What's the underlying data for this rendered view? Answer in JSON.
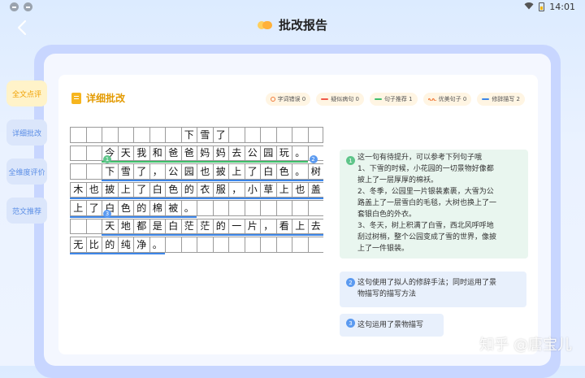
{
  "status_bar": {
    "time": "14:01"
  },
  "header": {
    "title": "批改报告"
  },
  "side_tabs": [
    {
      "label": "全文点评",
      "active": true
    },
    {
      "label": "详细批改",
      "active": false
    },
    {
      "label": "全维度评价",
      "active": false
    },
    {
      "label": "范文推荐",
      "active": false
    }
  ],
  "card": {
    "title": "详细批改",
    "legend": [
      {
        "label": "字词错误 0",
        "color": "#f07a3a",
        "mark": "circle"
      },
      {
        "label": "疑似病句 0",
        "color": "#f05a4a",
        "mark": "line"
      },
      {
        "label": "句子推荐 1",
        "color": "#3fbf6a",
        "mark": "line"
      },
      {
        "label": "优美句子 0",
        "color": "#f07a3a",
        "mark": "wave"
      },
      {
        "label": "修辞描写 2",
        "color": "#3d86e8",
        "mark": "line"
      }
    ]
  },
  "essay": {
    "rows": [
      [
        "",
        "",
        "",
        "",
        "",
        "",
        "",
        "下",
        "雪",
        "了",
        "",
        "",
        "",
        "",
        "",
        ""
      ],
      [
        "",
        "",
        "今",
        "天",
        "我",
        "和",
        "爸",
        "爸",
        "妈",
        "妈",
        "去",
        "公",
        "园",
        "玩",
        "。",
        ""
      ],
      [
        "",
        "",
        "下",
        "雪",
        "了",
        "，",
        "公",
        "园",
        "也",
        "披",
        "上",
        "了",
        "白",
        "色",
        "。",
        "树"
      ],
      [
        "木",
        "也",
        "披",
        "上",
        "了",
        "白",
        "色",
        "的",
        "衣",
        "服",
        "，",
        "小",
        "草",
        "上",
        "也",
        "盖"
      ],
      [
        "上",
        "了",
        "白",
        "色",
        "的",
        "棉",
        "被",
        "。",
        "",
        "",
        "",
        "",
        "",
        "",
        "",
        ""
      ],
      [
        "",
        "",
        "天",
        "地",
        "都",
        "是",
        "白",
        "茫",
        "茫",
        "的",
        "一",
        "片",
        "，",
        "看",
        "上",
        "去"
      ],
      [
        "无",
        "比",
        "的",
        "纯",
        "净",
        "。",
        "",
        "",
        "",
        "",
        "",
        "",
        "",
        "",
        "",
        ""
      ]
    ],
    "markers": [
      "1",
      "2",
      "3"
    ]
  },
  "comments": [
    {
      "num": "1",
      "lines": [
        "这一句有待提升，可以参考下列句子哦",
        "1、下雪的时候，小花园的一切景物好像都",
        "披上了一层厚厚的棉袄。",
        "2、冬季，公园里一片银装素裹，大雪为公",
        "路盖上了一层雪白的毛毯，大树也换上了一",
        "套银白色的外衣。",
        "3、冬天，树上积满了白雪，西北风呼呼地",
        "刮过树梢，整个公园变成了雪的世界，像披",
        "上了一件银装。"
      ]
    },
    {
      "num": "2",
      "lines": [
        "这句使用了拟人的修辞手法；同时运用了景",
        "物描写的描写方法"
      ]
    },
    {
      "num": "3",
      "lines": [
        "这句运用了景物描写"
      ]
    }
  ],
  "watermark": "知乎 @唐宝儿"
}
